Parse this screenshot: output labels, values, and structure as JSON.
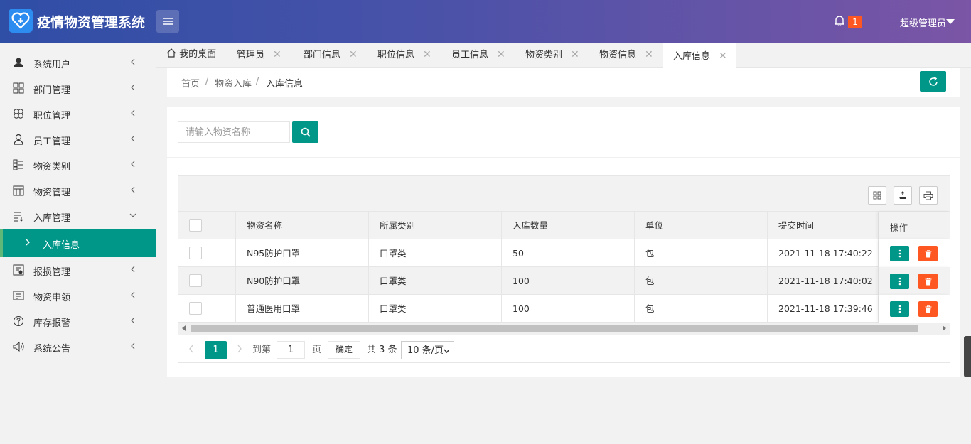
{
  "app": {
    "title": "疫情物资管理系统",
    "notification_count": "1",
    "user_name": "超级管理员"
  },
  "sidebar": {
    "items": [
      {
        "label": "系统用户",
        "icon": "user-icon"
      },
      {
        "label": "部门管理",
        "icon": "grid-icon"
      },
      {
        "label": "职位管理",
        "icon": "clover-icon"
      },
      {
        "label": "员工管理",
        "icon": "person-icon"
      },
      {
        "label": "物资类别",
        "icon": "list-icon"
      },
      {
        "label": "物资管理",
        "icon": "calendar-icon"
      },
      {
        "label": "入库管理",
        "icon": "list-lines-icon"
      },
      {
        "label": "报损管理",
        "icon": "report-icon"
      },
      {
        "label": "物资申领",
        "icon": "card-icon"
      },
      {
        "label": "库存报警",
        "icon": "question-icon"
      },
      {
        "label": "系统公告",
        "icon": "speaker-icon"
      }
    ],
    "active_sub": "入库信息"
  },
  "tabs": [
    {
      "label": "我的桌面"
    },
    {
      "label": "管理员"
    },
    {
      "label": "部门信息"
    },
    {
      "label": "职位信息"
    },
    {
      "label": "员工信息"
    },
    {
      "label": "物资类别"
    },
    {
      "label": "物资信息"
    },
    {
      "label": "入库信息"
    }
  ],
  "breadcrumb": [
    "首页",
    "物资入库",
    "入库信息"
  ],
  "search": {
    "placeholder": "请输入物资名称"
  },
  "table": {
    "columns": [
      "物资名称",
      "所属类别",
      "入库数量",
      "单位",
      "提交时间",
      "操作"
    ],
    "rows": [
      [
        "N95防护口罩",
        "口罩类",
        "50",
        "包",
        "2021-11-18 17:40:22"
      ],
      [
        "N90防护口罩",
        "口罩类",
        "100",
        "包",
        "2021-11-18 17:40:02"
      ],
      [
        "普通医用口罩",
        "口罩类",
        "100",
        "包",
        "2021-11-18 17:39:46"
      ]
    ]
  },
  "pager": {
    "current": "1",
    "goto_label": "到第",
    "goto_value": "1",
    "page_label": "页",
    "confirm_label": "确定",
    "total_label": "共 3 条",
    "page_size": "10 条/页"
  },
  "colors": {
    "primary": "#009688",
    "danger": "#ff5722"
  }
}
